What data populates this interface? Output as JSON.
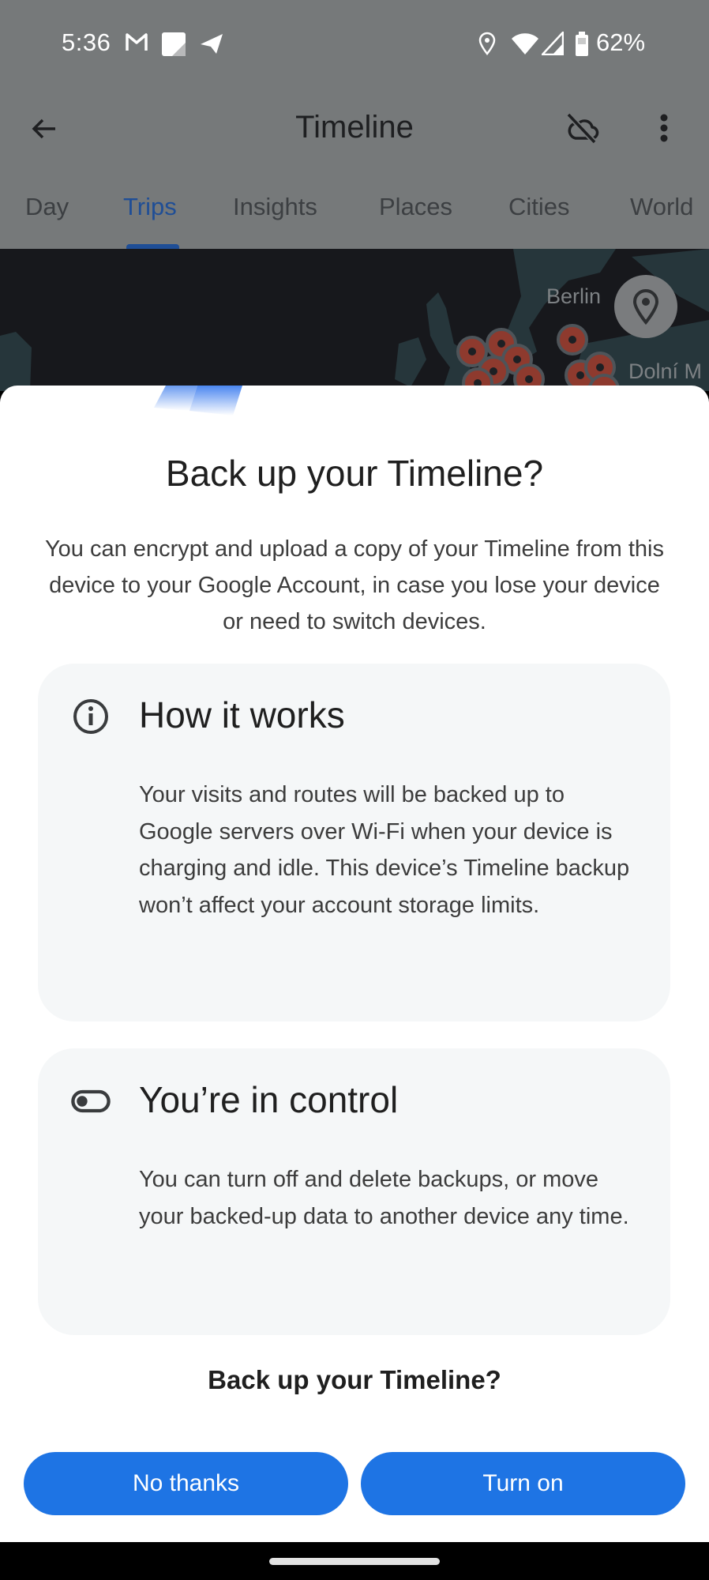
{
  "status_bar": {
    "time": "5:36",
    "left_icons": [
      "gmail-icon",
      "notes-icon",
      "telegram-icon"
    ],
    "right_icons": [
      "location-icon",
      "wifi-icon",
      "cell-signal-icon",
      "battery-icon"
    ],
    "battery_percent": "62%"
  },
  "app_bar": {
    "title": "Timeline",
    "back_icon": "arrow-back-icon",
    "actions": [
      "cloud-off-icon",
      "more-vert-icon"
    ]
  },
  "tabs": [
    {
      "label": "Day",
      "active": false
    },
    {
      "label": "Trips",
      "active": true
    },
    {
      "label": "Insights",
      "active": false
    },
    {
      "label": "Places",
      "active": false
    },
    {
      "label": "Cities",
      "active": false
    },
    {
      "label": "World",
      "active": false
    }
  ],
  "map": {
    "labels": [
      "Berlin",
      "Dolní M"
    ],
    "location_button_icon": "place-pin-icon"
  },
  "dialog": {
    "title": "Back up your Timeline?",
    "intro": "You can encrypt and upload a copy of your Timeline from this device to your Google Account, in case you lose your device or need to switch devices.",
    "cards": [
      {
        "icon": "info-icon",
        "heading": "How it works",
        "body": "Your visits and routes will be backed up to Google servers over Wi-Fi when your device is charging and idle. This device’s Timeline backup won’t affect your account storage limits."
      },
      {
        "icon": "toggle-icon",
        "heading": "You’re in control",
        "body": "You can turn off and delete backups, or move your backed-up data to another device any time."
      }
    ],
    "question": "Back up your Timeline?",
    "buttons": {
      "decline": "No thanks",
      "accept": "Turn on"
    }
  },
  "colors": {
    "primary_button": "#1e74e4",
    "active_tab": "#1f4e96",
    "card_background": "#f5f7f8"
  }
}
